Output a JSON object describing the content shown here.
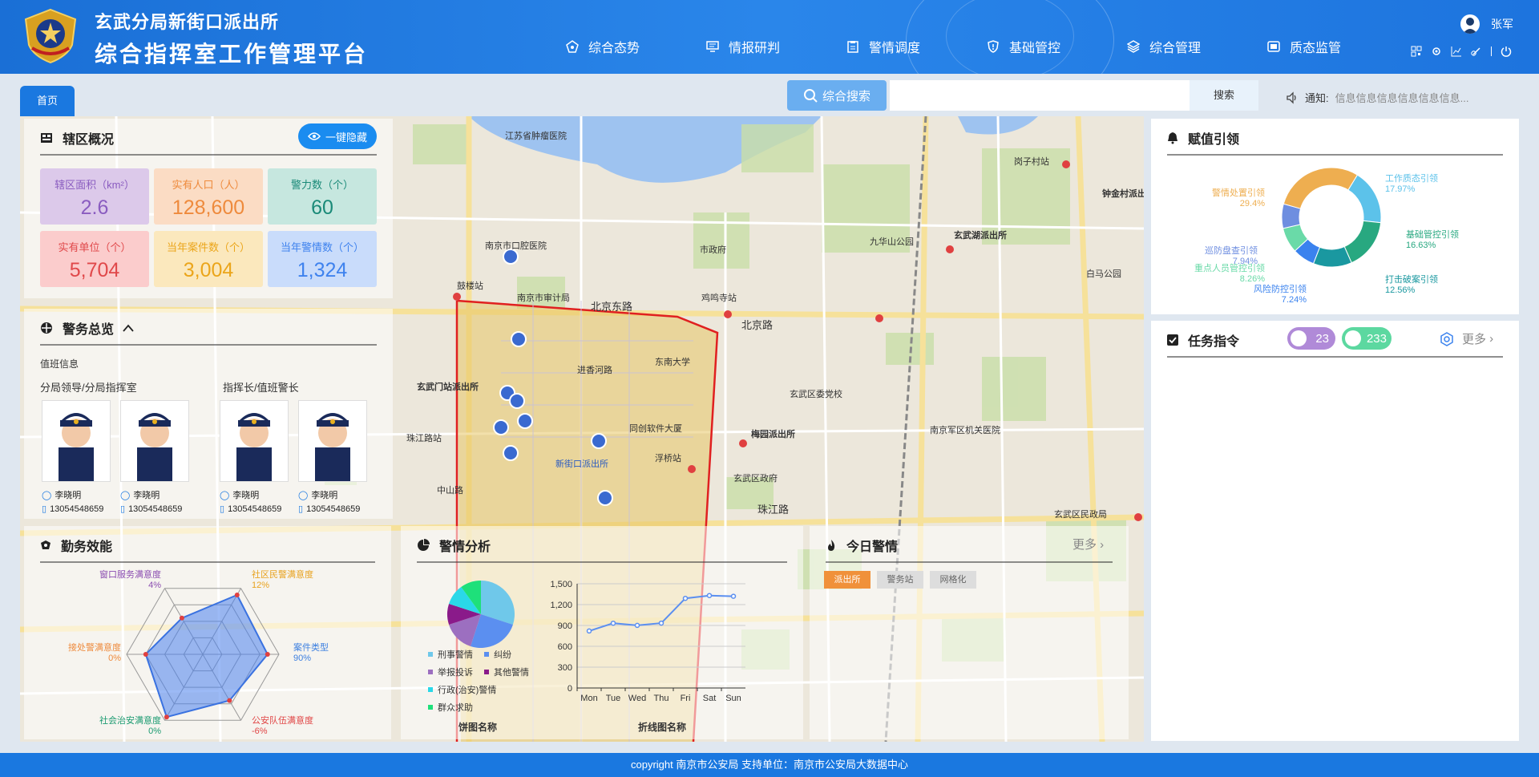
{
  "header": {
    "org": "玄武分局新街口派出所",
    "title": "综合指挥室工作管理平台",
    "nav": [
      {
        "label": "综合态势",
        "icon": "pentagon-icon"
      },
      {
        "label": "情报研判",
        "icon": "monitor-icon"
      },
      {
        "label": "警情调度",
        "icon": "clipboard-icon"
      },
      {
        "label": "基础管控",
        "icon": "shield-icon"
      },
      {
        "label": "综合管理",
        "icon": "layers-icon"
      },
      {
        "label": "质态监管",
        "icon": "screen-icon"
      }
    ],
    "user": "张军",
    "tools": [
      "qr-icon",
      "gear-icon",
      "chart-icon",
      "link-icon",
      "power-icon"
    ]
  },
  "tabs": {
    "home": "首页"
  },
  "search": {
    "button": "综合搜索",
    "placeholder": "",
    "go": "搜索"
  },
  "notice": {
    "label": "通知:",
    "text": "信息信息信息信息信息信息..."
  },
  "district": {
    "title": "辖区概况",
    "hide_button": "一键隐藏",
    "stats": [
      {
        "label": "辖区面积（km²）",
        "value": "2.6",
        "bg": "#dcc9ea",
        "color": "#8a5cc0"
      },
      {
        "label": "实有人口（人）",
        "value": "128,600",
        "bg": "#fbdcc4",
        "color": "#ee8a3c"
      },
      {
        "label": "警力数（个）",
        "value": "60",
        "bg": "#c6e7df",
        "color": "#1a8a78"
      },
      {
        "label": "实有单位（个）",
        "value": "5,704",
        "bg": "#fbcccc",
        "color": "#e0484a"
      },
      {
        "label": "当年案件数（个）",
        "value": "3,004",
        "bg": "#fbe8bd",
        "color": "#eba51a"
      },
      {
        "label": "当年警情数（个）",
        "value": "1,324",
        "bg": "#c9dcfb",
        "color": "#3e82ee"
      }
    ]
  },
  "police": {
    "title": "警务总览",
    "duty": "值班信息",
    "group1": "分局领导/分局指挥室",
    "group2": "指挥长/值班警长",
    "officers": [
      {
        "name": "李晓明",
        "phone": "13054548659"
      },
      {
        "name": "李晓明",
        "phone": "13054548659"
      },
      {
        "name": "李晓明",
        "phone": "13054548659"
      },
      {
        "name": "李晓明",
        "phone": "13054548659"
      }
    ]
  },
  "efficiency": {
    "title": "勤务效能",
    "axes": [
      {
        "name": "社区民警满意度",
        "pct": "12%",
        "color": "#e8a21e"
      },
      {
        "name": "案件类型",
        "pct": "90%",
        "color": "#3c7fe0"
      },
      {
        "name": "公安队伍满意度",
        "pct": "-6%",
        "color": "#e04545"
      },
      {
        "name": "社会治安满意度",
        "pct": "0%",
        "color": "#1a9a70"
      },
      {
        "name": "接处警满意度",
        "pct": "0%",
        "color": "#ee8a3c"
      },
      {
        "name": "窗口服务满意度",
        "pct": "4%",
        "color": "#8a4cb0"
      }
    ]
  },
  "analysis": {
    "title": "警情分析",
    "pie_name": "饼图名称",
    "line_name": "折线图名称",
    "legend": [
      {
        "label": "刑事警情",
        "color": "#6fc8ea"
      },
      {
        "label": "纠纷",
        "color": "#5b8ff0"
      },
      {
        "label": "举报投诉",
        "color": "#9c6fc0"
      },
      {
        "label": "其他警情",
        "color": "#8a1a8a"
      },
      {
        "label": "行政(治安)警情",
        "color": "#2ad8e8"
      },
      {
        "label": "群众求助",
        "color": "#1ee07a"
      }
    ]
  },
  "today": {
    "title": "今日警情",
    "more": "更多",
    "filters": [
      "派出所",
      "警务站",
      "网格化"
    ]
  },
  "guide": {
    "title": "赋值引领",
    "items": [
      {
        "name": "工作质态引领",
        "pct": "17.97%",
        "color": "#5cc2ea"
      },
      {
        "name": "基础管控引领",
        "pct": "16.63%",
        "color": "#28a880"
      },
      {
        "name": "打击破案引领",
        "pct": "12.56%",
        "color": "#1a98a0"
      },
      {
        "name": "风险防控引领",
        "pct": "7.24%",
        "color": "#3a82ee"
      },
      {
        "name": "重点人员管控引领",
        "pct": "8.26%",
        "color": "#6adaa8"
      },
      {
        "name": "巡防盘查引领",
        "pct": "7.94%",
        "color": "#6e8ee0"
      },
      {
        "name": "警情处置引领",
        "pct": "29.4%",
        "color": "#eeae50"
      }
    ]
  },
  "tasks": {
    "title": "任务指令",
    "badge1": "23",
    "badge2": "233",
    "more": "更多"
  },
  "map": {
    "labels": [
      "江苏省肿瘤医院",
      "南京市口腔医院",
      "南京市审计局",
      "市政府",
      "北京东路",
      "鸡鸣寺站",
      "九华山公园",
      "玄武湖派出所",
      "玄武门站派出所",
      "东南大学",
      "进香河路",
      "珠江路站",
      "浮桥站",
      "新街口派出所",
      "梅园派出所",
      "玄武区委党校",
      "南京军区机关医院",
      "玄武区政府",
      "北京路",
      "珠江路",
      "中山路",
      "鼓楼站",
      "白马公园",
      "岗子村站",
      "玄武区民政局",
      "同创软件大厦",
      "钟金村派出所"
    ]
  },
  "chart_data": [
    {
      "type": "line",
      "title": "",
      "xlabel": "折线图名称",
      "ylabel": "",
      "categories": [
        "Mon",
        "Tue",
        "Wed",
        "Thu",
        "Fri",
        "Sat",
        "Sun"
      ],
      "series": [
        {
          "values": [
            820,
            932,
            901,
            934,
            1290,
            1330,
            1320
          ]
        }
      ],
      "ylim": [
        0,
        1500
      ],
      "yticks": [
        "0",
        "300",
        "600",
        "900",
        "1,200",
        "1,500"
      ],
      "grid": true
    },
    {
      "type": "pie",
      "xlabel": "饼图名称",
      "categories": [
        "刑事警情",
        "纠纷",
        "举报投诉",
        "其他警情",
        "行政(治安)警情",
        "群众求助"
      ],
      "values": [
        30,
        25,
        15,
        10,
        10,
        10
      ]
    },
    {
      "type": "radar",
      "categories": [
        "社区民警满意度",
        "案件类型",
        "公安队伍满意度",
        "社会治安满意度",
        "接处警满意度",
        "窗口服务满意度"
      ],
      "values": [
        0.9,
        0.85,
        0.7,
        0.95,
        0.75,
        0.55
      ]
    },
    {
      "type": "pie",
      "categories": [
        "工作质态引领",
        "基础管控引领",
        "打击破案引领",
        "风险防控引领",
        "重点人员管控引领",
        "巡防盘查引领",
        "警情处置引领"
      ],
      "values": [
        17.97,
        16.63,
        12.56,
        7.24,
        8.26,
        7.94,
        29.4
      ]
    }
  ]
}
